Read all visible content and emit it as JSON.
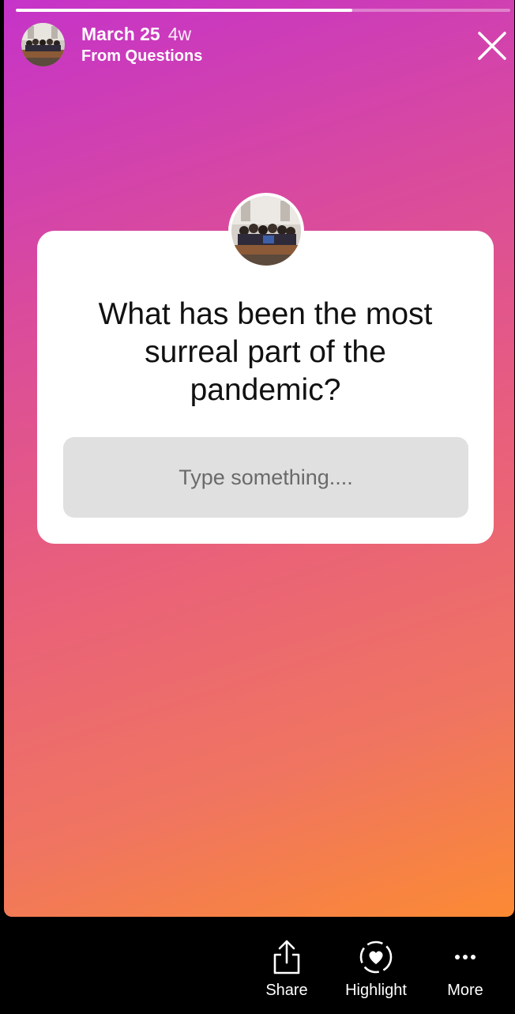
{
  "story": {
    "progress": 0.68,
    "header": {
      "date": "March 25",
      "age": "4w",
      "source": "From Questions"
    }
  },
  "card": {
    "question": "What has been the most surreal part of the pandemic?",
    "input_placeholder": "Type something...."
  },
  "actions": {
    "share": "Share",
    "highlight": "Highlight",
    "more": "More"
  },
  "icons": {
    "close": "close-icon",
    "share": "share-icon",
    "highlight": "highlight-heart-icon",
    "more": "more-icon"
  },
  "colors": {
    "gradient_start": "#c533c9",
    "gradient_end": "#fb8a34",
    "card_bg": "#ffffff",
    "input_bg": "#e0e0e0"
  }
}
